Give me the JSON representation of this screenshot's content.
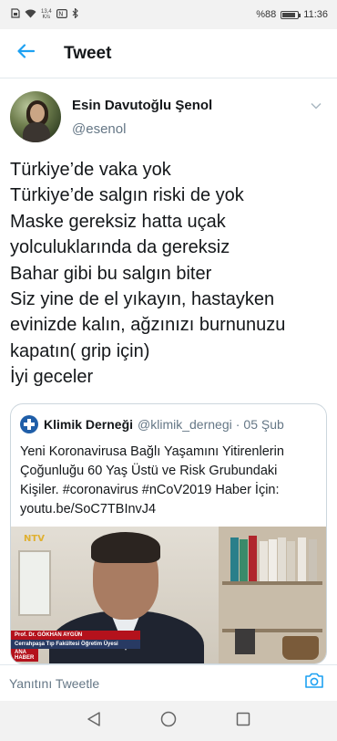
{
  "status_bar": {
    "net_speed_value": "13,4",
    "net_speed_unit": "K/s",
    "battery_percent": "%88",
    "battery_level": 0.88,
    "time": "11:36",
    "icons": [
      "sim-icon",
      "wifi-icon",
      "nfc-icon",
      "bluetooth-icon",
      "battery-icon"
    ]
  },
  "header": {
    "title": "Tweet",
    "back_icon": "arrow-left-icon"
  },
  "tweet": {
    "author_name": "Esin Davutoğlu Şenol",
    "author_handle": "@esenol",
    "text_lines": [
      "Türkiye’de vaka yok",
      "Türkiye’de salgın riski de yok",
      "Maske gereksiz hatta uçak",
      "yolculuklarında da gereksiz",
      "Bahar gibi bu salgın biter",
      "Siz yine de el yıkayın, hastayken",
      "evinizde kalın, ağzınızı burnunuzu",
      "kapatın( grip için)",
      "İyi geceler"
    ]
  },
  "quote": {
    "author_name": "Klimik Derneği",
    "author_handle": "@klimik_dernegi",
    "separator": "·",
    "date": "05 Şub",
    "text_lines": [
      "Yeni Koronavirusa Bağlı Yaşamını Yitirenlerin",
      "Çoğunluğu 60 Yaş Üstü ve Risk Grubundaki",
      "Kişiler. #coronavirus #nCoV2019 Haber İçin:",
      "youtu.be/SoC7TBInvJ4"
    ],
    "media": {
      "channel_logo": "NTV",
      "caption_name": "Prof. Dr. GÖKHAN AYGÜN",
      "caption_title": "Cerrahpaşa Tıp Fakültesi Öğretim Üyesi",
      "caption_tag": "ANA HABER"
    }
  },
  "reply": {
    "placeholder": "Yanıtını Tweetle",
    "camera_icon": "camera-icon"
  },
  "nav": {
    "icons": [
      "back-triangle-icon",
      "home-circle-icon",
      "recents-square-icon"
    ]
  },
  "colors": {
    "accent": "#1da1f2",
    "text": "#14171a",
    "secondary": "#657786",
    "border": "#ccd6dd"
  }
}
